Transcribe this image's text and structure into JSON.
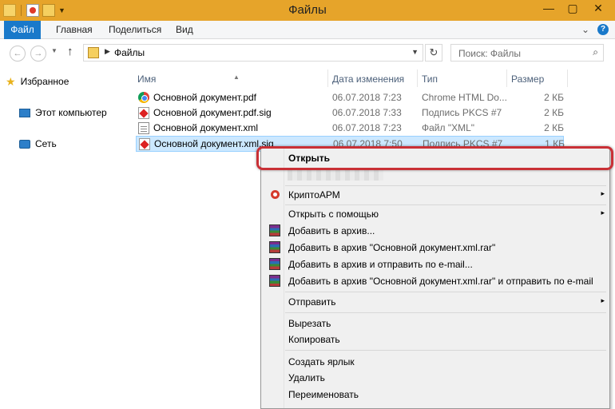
{
  "window": {
    "title": "Файлы",
    "controls": {
      "minimize": "—",
      "maximize": "▢",
      "close": "✕"
    }
  },
  "ribbon": {
    "tabs": [
      "Файл",
      "Главная",
      "Поделиться",
      "Вид"
    ],
    "right": {
      "expand": "⌄",
      "help": "?"
    }
  },
  "address": {
    "path": "Файлы",
    "search_placeholder": "Поиск: Файлы"
  },
  "nav": {
    "items": [
      "Избранное",
      "Этот компьютер",
      "Сеть"
    ]
  },
  "columns": [
    "Имя",
    "Дата изменения",
    "Тип",
    "Размер"
  ],
  "files": [
    {
      "name": "Основной документ.pdf",
      "date": "06.07.2018 7:23",
      "type": "Chrome HTML Do...",
      "size": "2 КБ",
      "icon": "chrome-icon"
    },
    {
      "name": "Основной документ.pdf.sig",
      "date": "06.07.2018 7:33",
      "type": "Подпись PKCS #7",
      "size": "2 КБ",
      "icon": "signature-icon"
    },
    {
      "name": "Основной документ.xml",
      "date": "06.07.2018 7:23",
      "type": "Файл \"XML\"",
      "size": "2 КБ",
      "icon": "xml-file-icon"
    },
    {
      "name": "Основной документ.xml.sig",
      "date": "06.07.2018 7:50",
      "type": "Подпись PKCS #7",
      "size": "1 КБ",
      "icon": "signature-icon"
    }
  ],
  "context_menu": {
    "open": "Открыть",
    "items": [
      {
        "label": "КриптоАРМ",
        "submenu": true
      },
      {
        "label": "Открыть с помощью",
        "submenu": true
      },
      {
        "label": "Добавить в архив..."
      },
      {
        "label": "Добавить в архив \"Основной документ.xml.rar\""
      },
      {
        "label": "Добавить в архив и отправить по e-mail..."
      },
      {
        "label": "Добавить в архив \"Основной документ.xml.rar\" и отправить по e-mail"
      },
      {
        "label": "Отправить",
        "submenu": true
      },
      {
        "label": "Вырезать"
      },
      {
        "label": "Копировать"
      },
      {
        "label": "Создать ярлык"
      },
      {
        "label": "Удалить"
      },
      {
        "label": "Переименовать"
      }
    ],
    "submenu_arrow": "▸"
  },
  "colors": {
    "titlebar": "#e6a42a",
    "file_tab": "#1979ca",
    "highlight": "#c93036",
    "selection": "#cce8ff"
  }
}
